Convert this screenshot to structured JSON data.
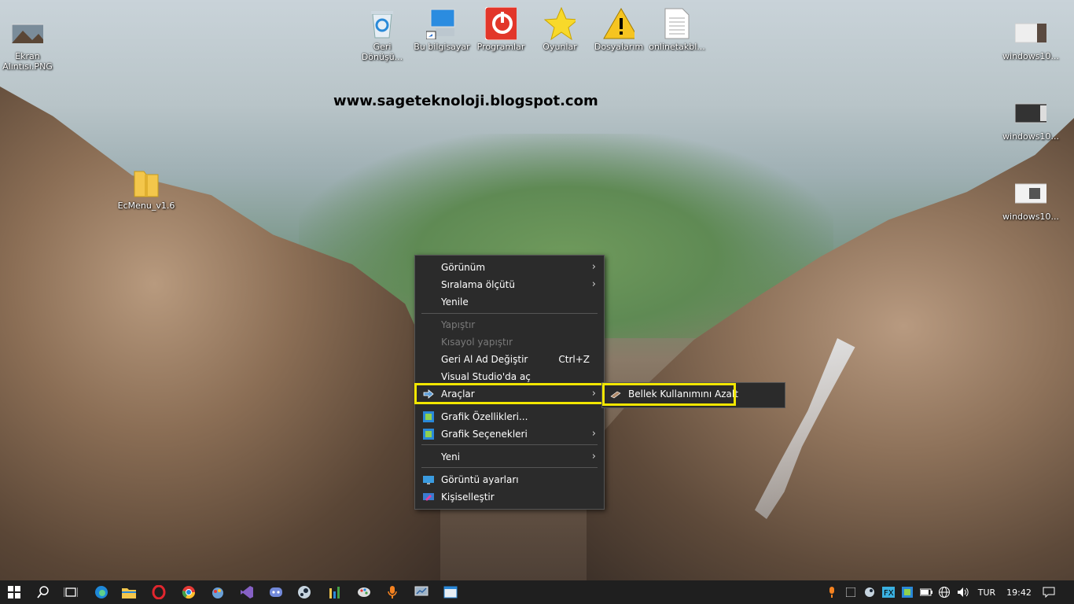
{
  "desktop": {
    "watermark": "www.sageteknoloji.blogspot.com",
    "icons": [
      {
        "label": "Ekran\nAlıntısı.PNG"
      },
      {
        "label": "Geri\nDönüşü..."
      },
      {
        "label": "Bu bilgisayar"
      },
      {
        "label": "Programlar"
      },
      {
        "label": "Oyunlar"
      },
      {
        "label": "Dosyalarım"
      },
      {
        "label": "onlinetakbl..."
      },
      {
        "label": "EcMenu_v1.6"
      },
      {
        "label": "windows10..."
      },
      {
        "label": "windows10..."
      },
      {
        "label": "windows10..."
      }
    ]
  },
  "context_menu": {
    "items": [
      {
        "label": "Görünüm"
      },
      {
        "label": "Sıralama ölçütü"
      },
      {
        "label": "Yenile"
      },
      {
        "label": "Yapıştır"
      },
      {
        "label": "Kısayol yapıştır"
      },
      {
        "label": "Geri Al Ad Değiştir",
        "shortcut": "Ctrl+Z"
      },
      {
        "label": "Visual Studio'da aç"
      },
      {
        "label": "Araçlar"
      },
      {
        "label": "Grafik Özellikleri..."
      },
      {
        "label": "Grafik Seçenekleri"
      },
      {
        "label": "Yeni"
      },
      {
        "label": "Görüntü ayarları"
      },
      {
        "label": "Kişiselleştir"
      }
    ]
  },
  "submenu": {
    "item": "Bellek Kullanımını Azalt"
  },
  "taskbar": {
    "language": "TUR",
    "time": "19:42"
  },
  "colors": {
    "highlight": "#f2e600",
    "menu_bg": "#2b2b2b",
    "taskbar_bg": "#1f1f1f"
  }
}
